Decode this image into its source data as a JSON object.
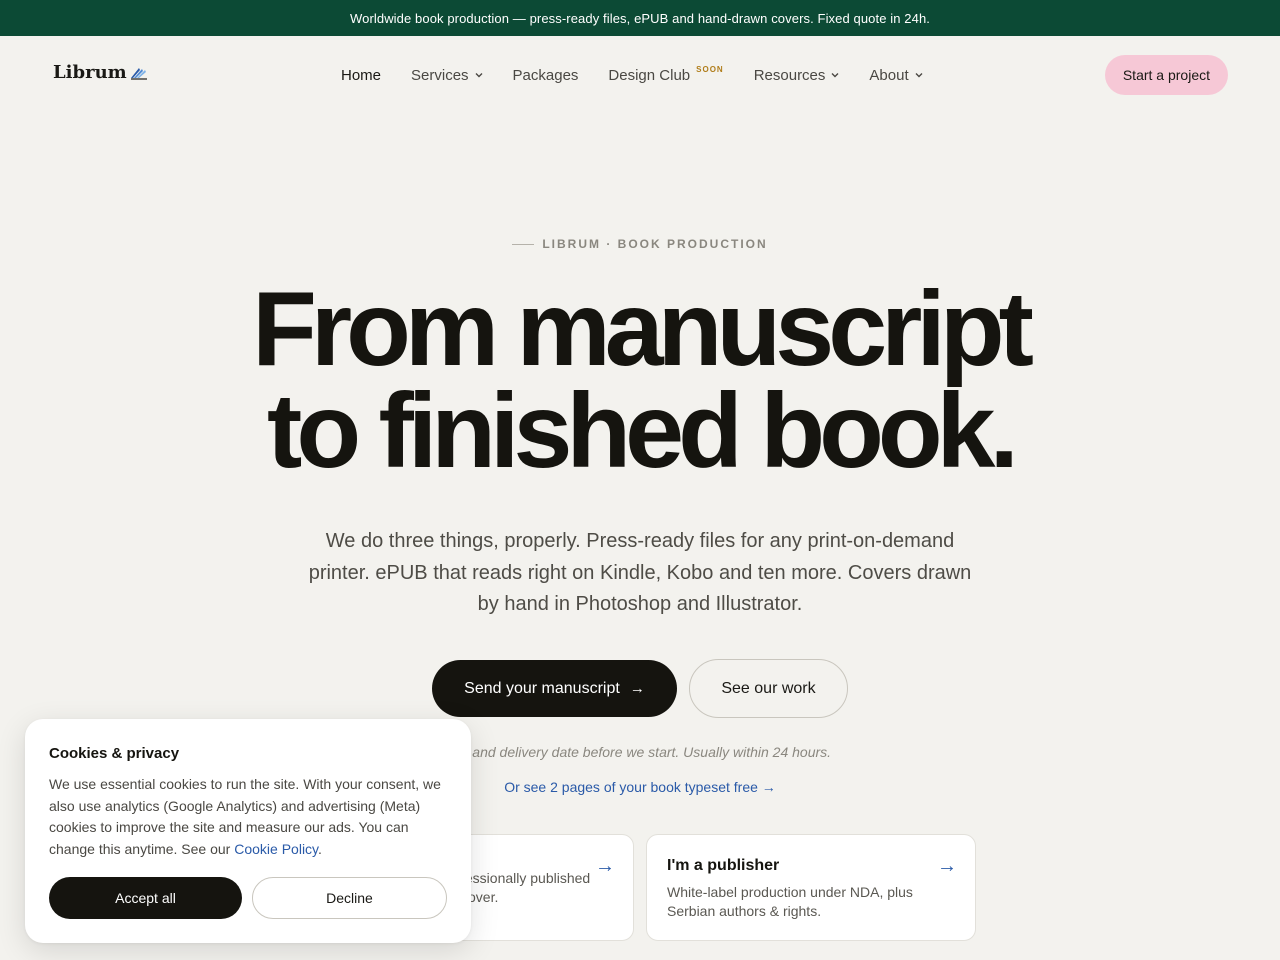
{
  "announcement": "Worldwide book production — press-ready files, ePUB and hand-drawn covers. Fixed quote in 24h.",
  "brand": {
    "name": "Librum",
    "logo_icon": "book-wings-icon"
  },
  "nav": {
    "items": [
      {
        "label": "Home",
        "has_dropdown": false
      },
      {
        "label": "Services",
        "has_dropdown": true
      },
      {
        "label": "Packages",
        "has_dropdown": false
      },
      {
        "label": "Design Club",
        "has_dropdown": false,
        "badge": "SOON"
      },
      {
        "label": "Resources",
        "has_dropdown": true
      },
      {
        "label": "About",
        "has_dropdown": true
      }
    ],
    "cta": "Start a project"
  },
  "hero": {
    "eyebrow": "LIBRUM · BOOK PRODUCTION",
    "headline_line1": "From manuscript",
    "headline_line2": "to finished book.",
    "lede": "We do three things, properly. Press-ready files for any print-on-demand printer. ePUB that reads right on Kindle, Kobo and ten more. Covers drawn by hand in Photoshop and Illustrator.",
    "primary_cta": "Send your manuscript",
    "secondary_cta": "See our work",
    "note": "ote and delivery date before we start. Usually within 24 hours.",
    "sample_link": "Or see 2 pages of your book typeset free →"
  },
  "cards": [
    {
      "title": "",
      "text_line1": "fessionally published",
      "text_line2": "cover."
    },
    {
      "title": "I'm a publisher",
      "text_line1": "White-label production under NDA, plus",
      "text_line2": "Serbian authors & rights."
    }
  ],
  "cookie": {
    "title": "Cookies & privacy",
    "text": "We use essential cookies to run the site. With your consent, we also use analytics (Google Analytics) and advertising (Meta) cookies to improve the site and measure our ads. You can change this anytime. See our ",
    "link": "Cookie Policy",
    "text_end": ".",
    "accept": "Accept all",
    "decline": "Decline"
  },
  "colors": {
    "announcement_bg": "#0c4a35",
    "page_bg": "#f3f2ee",
    "cta_pink": "#f6c8d6",
    "link_blue": "#2a5aa8",
    "soon_badge": "#b07d1a"
  }
}
